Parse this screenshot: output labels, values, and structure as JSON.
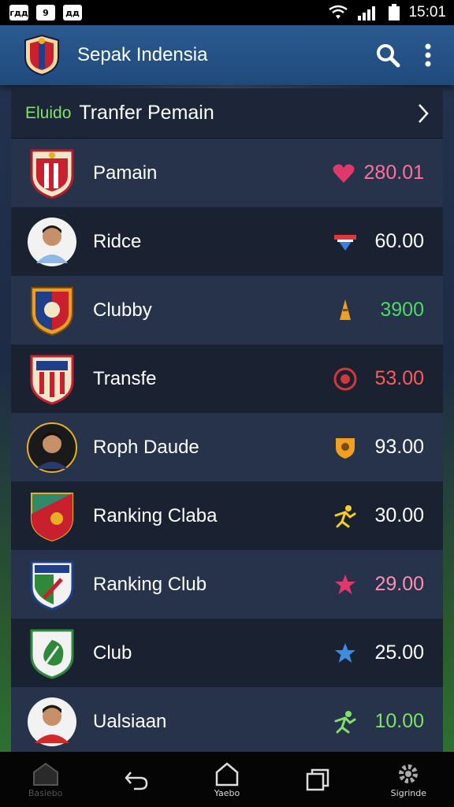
{
  "status_bar": {
    "left_icons": [
      "гдд",
      "9",
      "дд"
    ],
    "time": "15:01"
  },
  "app_bar": {
    "title": "Sepak Indensia",
    "icons": [
      "search-icon",
      "more-vert-icon"
    ]
  },
  "section": {
    "tag": "Eluido",
    "title": "Tranfer Pemain"
  },
  "rows": [
    {
      "name": "Pamain",
      "value": "280.01",
      "value_color": "#ff6fa0",
      "badge": "heart-badge",
      "badge_color": "#e0386b",
      "logo": "club-crest-red"
    },
    {
      "name": "Ridce",
      "value": "60.00",
      "value_color": "#ffffff",
      "badge": "flag-badge",
      "badge_color": "#3b7de0",
      "logo": "player-photo"
    },
    {
      "name": "Clubby",
      "value": "3900",
      "value_color": "#4cd964",
      "badge": "cone-badge",
      "badge_color": "#f0a020",
      "logo": "club-crest-blue"
    },
    {
      "name": "Transfe",
      "value": "53.00",
      "value_color": "#ff5a5a",
      "badge": "ball-badge",
      "badge_color": "#d0383a",
      "logo": "club-crest-stripes"
    },
    {
      "name": "Roph Daude",
      "value": "93.00",
      "value_color": "#ffffff",
      "badge": "shield-badge",
      "badge_color": "#f0a020",
      "logo": "player-photo"
    },
    {
      "name": "Ranking Claba",
      "value": "30.00",
      "value_color": "#ffffff",
      "badge": "runner-badge",
      "badge_color": "#f5d020",
      "logo": "club-crest-green-red"
    },
    {
      "name": "Ranking Club",
      "value": "29.00",
      "value_color": "#ff8fb0",
      "badge": "star-badge",
      "badge_color": "#e0386b",
      "logo": "club-crest-green-white"
    },
    {
      "name": "Club",
      "value": "25.00",
      "value_color": "#ffffff",
      "badge": "star-badge",
      "badge_color": "#3b8de0",
      "logo": "club-crest-green-leaf"
    },
    {
      "name": "Ualsiaan",
      "value": "10.00",
      "value_color": "#7fe06a",
      "badge": "runner-badge",
      "badge_color": "#7fe06a",
      "logo": "player-photo"
    }
  ],
  "nav_bar": {
    "items": [
      {
        "label": "Basiebo",
        "icon": "home-icon"
      },
      {
        "label": "",
        "icon": "back-icon"
      },
      {
        "label": "Yaebo",
        "icon": "home-outline-icon"
      },
      {
        "label": "",
        "icon": "recents-icon"
      },
      {
        "label": "Sigrinde",
        "icon": "settings-icon"
      }
    ]
  }
}
